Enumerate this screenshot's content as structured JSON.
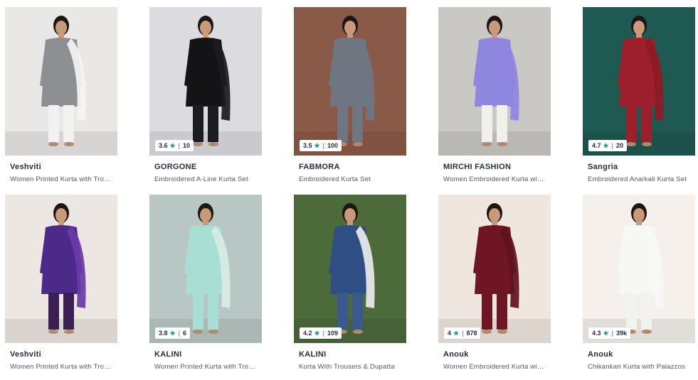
{
  "products": [
    {
      "brand": "Veshviti",
      "desc": "Women Printed Kurta with Tro…",
      "rating": "",
      "count": "",
      "colors": {
        "bg": "#e9e8e6",
        "outfit": "#8d8f92",
        "dupatta": "#f4f4f4",
        "bottom": "#f2f2f2"
      }
    },
    {
      "brand": "GORGONE",
      "desc": "Embroidered A-Line Kurta Set",
      "rating": "3.6",
      "count": "10",
      "colors": {
        "bg": "#dcdbdf",
        "outfit": "#141316",
        "dupatta": "#1c1b1f",
        "bottom": "#1c1b1f"
      }
    },
    {
      "brand": "FABMORA",
      "desc": "Embroidered Kurta Set",
      "rating": "3.5",
      "count": "100",
      "colors": {
        "bg": "#8a5a48",
        "outfit": "#6f7682",
        "dupatta": "#6f7682",
        "bottom": "#6f7682"
      }
    },
    {
      "brand": "MIRCHI FASHION",
      "desc": "Women Embroidered Kurta wi…",
      "rating": "",
      "count": "",
      "colors": {
        "bg": "#c9c8c4",
        "outfit": "#8f86e0",
        "dupatta": "#8f86e0",
        "bottom": "#f1f1ec"
      }
    },
    {
      "brand": "Sangria",
      "desc": "Embroidered Anarkali Kurta Set",
      "rating": "4.7",
      "count": "20",
      "colors": {
        "bg": "#1f5a52",
        "outfit": "#9d1f2b",
        "dupatta": "#8e1a26",
        "bottom": "#9d1f2b"
      }
    },
    {
      "brand": "Veshviti",
      "desc": "Women Printed Kurta with Tro…",
      "rating": "",
      "count": "",
      "colors": {
        "bg": "#ece7e2",
        "outfit": "#4c2a8a",
        "dupatta": "#6a3aa8",
        "bottom": "#3a1f55"
      }
    },
    {
      "brand": "KALINI",
      "desc": "Women Printed Kurta with Tro…",
      "rating": "3.8",
      "count": "6",
      "colors": {
        "bg": "#b9c7c4",
        "outfit": "#a8ded3",
        "dupatta": "#d8ebe6",
        "bottom": "#a8ded3"
      }
    },
    {
      "brand": "KALINI",
      "desc": "Kurta With Trousers & Dupatta",
      "rating": "4.2",
      "count": "109",
      "colors": {
        "bg": "#4d6a3a",
        "outfit": "#2f4f84",
        "dupatta": "#ececec",
        "bottom": "#3a5a8f"
      }
    },
    {
      "brand": "Anouk",
      "desc": "Women Embroidered Kurta wi…",
      "rating": "4",
      "count": "878",
      "colors": {
        "bg": "#efe6df",
        "outfit": "#6f1624",
        "dupatta": "#5f1220",
        "bottom": "#6f1624"
      }
    },
    {
      "brand": "Anouk",
      "desc": "Chikankari Kurta with Palazzos",
      "rating": "4.3",
      "count": "39k",
      "colors": {
        "bg": "#f5f0ec",
        "outfit": "#f7f7f5",
        "dupatta": "#f7f7f5",
        "bottom": "#f2f2ef"
      }
    }
  ],
  "icons": {
    "star": "star-icon"
  }
}
